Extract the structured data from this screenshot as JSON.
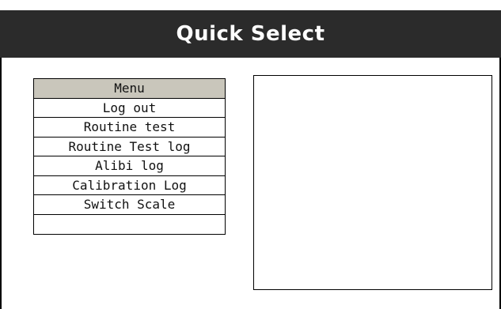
{
  "window": {
    "title": "Quick Select"
  },
  "menu": {
    "header": "Menu",
    "items": [
      {
        "label": "Log out"
      },
      {
        "label": "Routine test"
      },
      {
        "label": "Routine Test log"
      },
      {
        "label": "Alibi log"
      },
      {
        "label": "Calibration Log"
      },
      {
        "label": "Switch Scale"
      },
      {
        "label": ""
      }
    ]
  },
  "colors": {
    "title_bar_bg": "#2b2b2b",
    "title_text": "#ffffff",
    "menu_header_bg": "#c9c6bb",
    "border": "#000000"
  }
}
